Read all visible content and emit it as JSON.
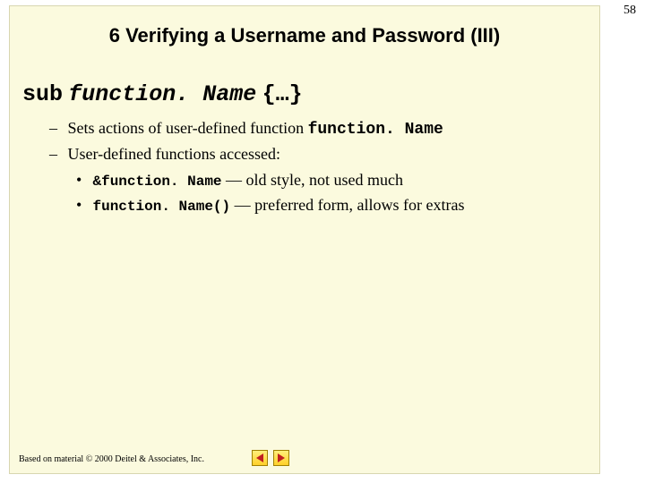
{
  "page_number": "58",
  "title": "6 Verifying a Username and Password (III)",
  "main": {
    "kw": "sub",
    "fn": "function. Name",
    "brace": "{…}"
  },
  "bullets": {
    "b1_prefix": "Sets actions of user-defined function ",
    "b1_code": "function. Name",
    "b2": "User-defined functions accessed:",
    "s1_code": "&function. Name",
    "s1_text": " — old style, not used much",
    "s2_code": "function. Name()",
    "s2_text": " —  preferred form, allows for extras"
  },
  "footer": "Based on material © 2000 Deitel & Associates, Inc."
}
